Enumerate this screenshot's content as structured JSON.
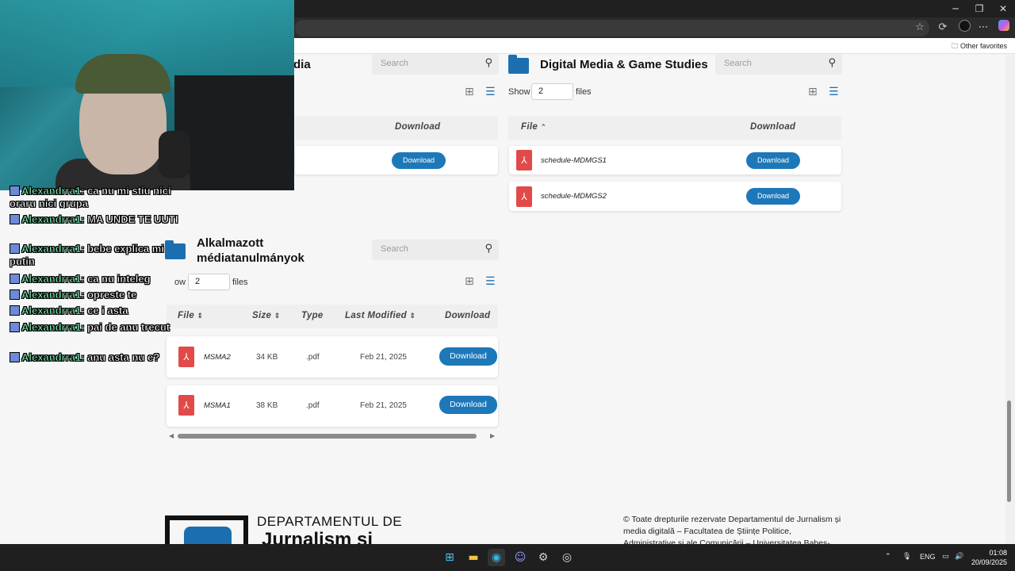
{
  "browser": {
    "other_favorites": "Other favorites"
  },
  "sections": {
    "top_left": {
      "title": "dia",
      "download_header": "Download",
      "download_label": "Download"
    },
    "top_right": {
      "title": "Digital Media & Game Studies",
      "search_placeholder": "Search",
      "show_label": "Show",
      "show_value": "2",
      "files_label": "files",
      "col_file": "File",
      "col_download": "Download",
      "rows": [
        {
          "name": "schedule-MDMGS1",
          "download": "Download"
        },
        {
          "name": "schedule-MDMGS2",
          "download": "Download"
        }
      ]
    },
    "bottom_left": {
      "title_line1": "Alkalmazott",
      "title_line2": "médiatanulmányok",
      "search_placeholder": "Search",
      "show_label": "ow",
      "show_value": "2",
      "files_label": "files",
      "col_file": "File",
      "col_size": "Size",
      "col_type": "Type",
      "col_modified": "Last Modified",
      "col_download": "Download",
      "rows": [
        {
          "name": "MSMA2",
          "size": "34 KB",
          "type": ".pdf",
          "modified": "Feb 21, 2025",
          "download": "Download"
        },
        {
          "name": "MSMA1",
          "size": "38 KB",
          "type": ".pdf",
          "modified": "Feb 21, 2025",
          "download": "Download"
        }
      ]
    },
    "top_left_search_placeholder": "Search"
  },
  "footer": {
    "logo_line1": "DEPARTAMENTUL DE",
    "logo_line2": "Jurnalism și",
    "copyright": "© Toate drepturile rezervate Departamentul de Jurnalism și media digitală – Facultatea de Științe Politice, Administrative și ale Comunicării – Universitatea Babeș-"
  },
  "chat": [
    {
      "user": "Alexandrra1:",
      "msg": "ca nu mi stiu nici oraru nici grupa"
    },
    {
      "user": "Alexandrra1:",
      "msg": "MA UNDE TE UUTI"
    },
    {
      "user": "Alexandrra1:",
      "msg": "bebe explica mi putin"
    },
    {
      "user": "Alexandrra1:",
      "msg": "ca nu inteleg"
    },
    {
      "user": "Alexandrra1:",
      "msg": "opreste te"
    },
    {
      "user": "Alexandrra1:",
      "msg": "ce i asta"
    },
    {
      "user": "Alexandrra1:",
      "msg": "pai de anu trecut"
    },
    {
      "user": "Alexandrra1:",
      "msg": "anu asta nu e?"
    }
  ],
  "taskbar": {
    "lang": "ENG",
    "time": "01:08",
    "date": "20/09/2025"
  },
  "icons": [
    "search-icon",
    "grid-view-icon",
    "list-view-icon",
    "folder-icon",
    "pdf-icon",
    "sort-icon"
  ]
}
